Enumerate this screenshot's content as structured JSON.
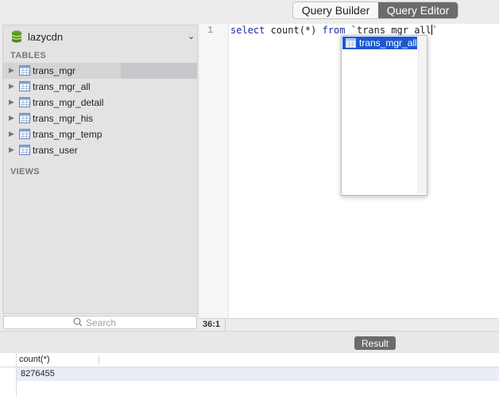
{
  "toolbar": {
    "query_builder_label": "Query Builder",
    "query_editor_label": "Query Editor"
  },
  "sidebar": {
    "database": "lazycdn",
    "tables_header": "TABLES",
    "views_header": "VIEWS",
    "tables": [
      {
        "label": "trans_mgr",
        "selected": true
      },
      {
        "label": "trans_mgr_all"
      },
      {
        "label": "trans_mgr_detail"
      },
      {
        "label": "trans_mgr_his"
      },
      {
        "label": "trans_mgr_temp"
      },
      {
        "label": "trans_user"
      }
    ],
    "search_placeholder": "Search"
  },
  "editor": {
    "line_number": "1",
    "kw_select": "select",
    "text_count": " count(*) ",
    "kw_from": "from",
    "text_table": " `trans_mgr_all",
    "text_tick": "`",
    "cursor_position": "36:1"
  },
  "autocomplete": {
    "items": [
      {
        "label": "trans_mgr_all",
        "icon": "table-icon"
      }
    ]
  },
  "results": {
    "button_label": "Result",
    "columns": [
      "count(*)"
    ],
    "rows": [
      [
        "8276455"
      ]
    ]
  },
  "colors": {
    "selection": "#1b59d1",
    "segment_active": "#6b6b6b",
    "keyword": "#1c2ea0"
  }
}
